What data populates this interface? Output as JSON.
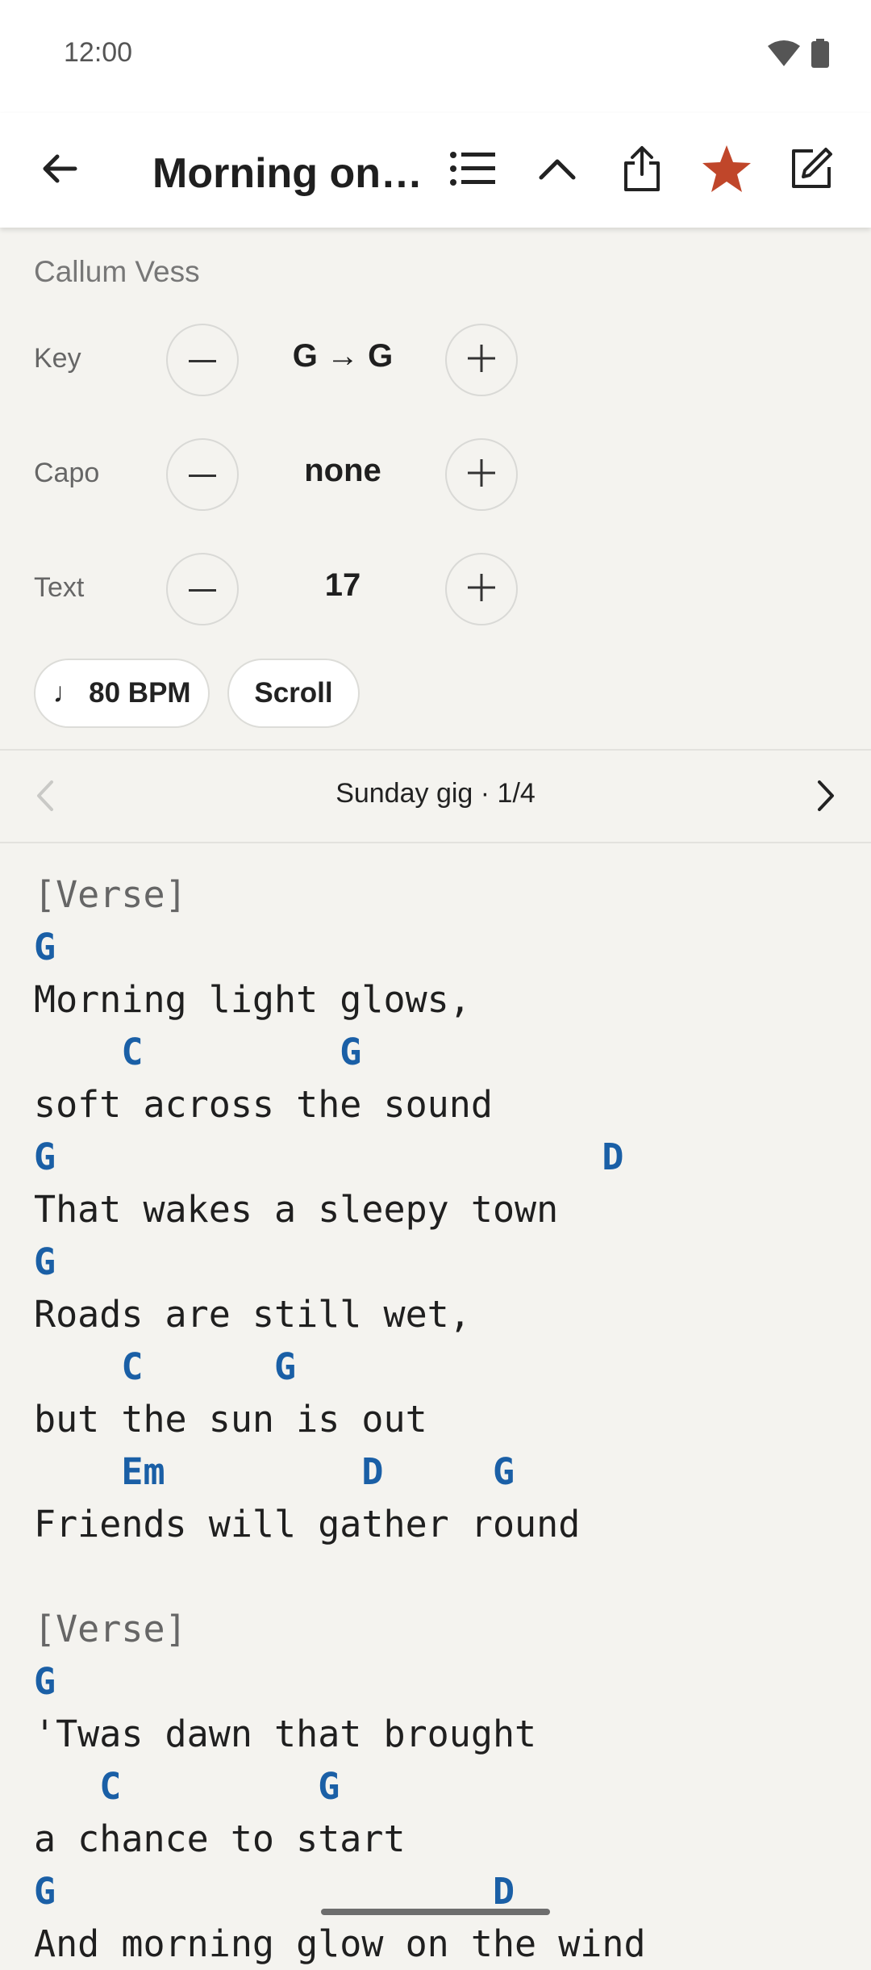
{
  "status_bar": {
    "time": "12:00"
  },
  "app_bar": {
    "title": "Morning on t..."
  },
  "song": {
    "artist": "Callum Vess",
    "controls": [
      {
        "label": "Key",
        "value": "G → G"
      },
      {
        "label": "Capo",
        "value": "none"
      },
      {
        "label": "Text",
        "value": "17"
      }
    ],
    "bpm_label": "♩ 80 BPM",
    "scroll_label": "Scroll"
  },
  "setlist": {
    "label": "Sunday gig · 1/4"
  },
  "lyrics": [
    {
      "type": "section",
      "text": "[Verse]"
    },
    {
      "type": "chord",
      "text": "G"
    },
    {
      "type": "lyric",
      "text": "Morning light glows,"
    },
    {
      "type": "chord",
      "text": "    C         G"
    },
    {
      "type": "lyric",
      "text": "soft across the sound"
    },
    {
      "type": "chord",
      "text": "G                         D"
    },
    {
      "type": "lyric",
      "text": "That wakes a sleepy town"
    },
    {
      "type": "chord",
      "text": "G"
    },
    {
      "type": "lyric",
      "text": "Roads are still wet,"
    },
    {
      "type": "chord",
      "text": "    C      G"
    },
    {
      "type": "lyric",
      "text": "but the sun is out"
    },
    {
      "type": "chord",
      "text": "    Em         D     G"
    },
    {
      "type": "lyric",
      "text": "Friends will gather round"
    },
    {
      "type": "blank",
      "text": ""
    },
    {
      "type": "section",
      "text": "[Verse]"
    },
    {
      "type": "chord",
      "text": "G"
    },
    {
      "type": "lyric",
      "text": "'Twas dawn that brought"
    },
    {
      "type": "chord",
      "text": "   C         G"
    },
    {
      "type": "lyric",
      "text": "a chance to start"
    },
    {
      "type": "chord",
      "text": "G                    D"
    },
    {
      "type": "lyric",
      "text": "And morning glow on the wind"
    }
  ],
  "colors": {
    "accent_star": "#c0462a",
    "chord": "#1a5fa6",
    "background": "#f4f3ef"
  }
}
